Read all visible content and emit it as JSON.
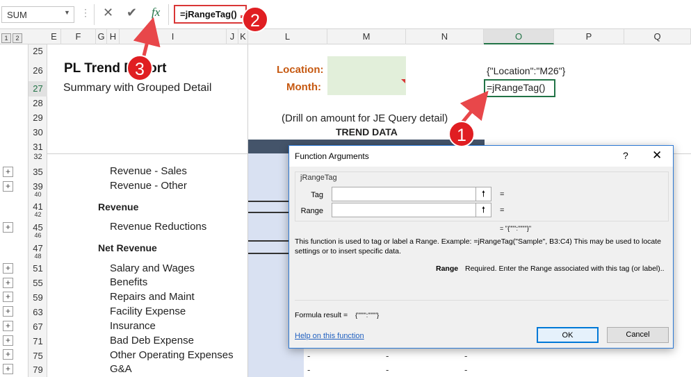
{
  "formula_bar": {
    "name_box": "SUM",
    "cancel_icon": "✕",
    "enter_icon": "✔",
    "fx_label": "fx",
    "formula": "=jRangeTag()"
  },
  "outline_levels": [
    "1",
    "2"
  ],
  "columns": [
    "E",
    "F",
    "G",
    "H",
    "I",
    "J",
    "K",
    "L",
    "M",
    "N",
    "O",
    "P",
    "Q"
  ],
  "rows_top": [
    "25",
    "26",
    "27",
    "28",
    "29",
    "30",
    "31"
  ],
  "rows_bottom": [
    "32",
    "35",
    "39",
    "40",
    "41",
    "42",
    "45",
    "46",
    "47",
    "48",
    "51",
    "55",
    "59",
    "63",
    "67",
    "71",
    "75",
    "79"
  ],
  "report": {
    "title": "PL Trend Report",
    "subtitle": "Summary with Grouped Detail",
    "location_label": "Location:",
    "month_label": "Month:",
    "drill_note": "(Drill on amount for JE Query detail)",
    "trend_header": "TREND DATA",
    "o26": "{\"Location\":\"M26\"}",
    "o27": "=jRangeTag()"
  },
  "line_items": [
    {
      "row": "35",
      "label": "Revenue - Sales",
      "bold": false
    },
    {
      "row": "39",
      "label": "Revenue - Other",
      "bold": false
    },
    {
      "row": "41",
      "label": "Revenue",
      "bold": true
    },
    {
      "row": "45",
      "label": "Revenue Reductions",
      "bold": false
    },
    {
      "row": "47",
      "label": "Net Revenue",
      "bold": true
    },
    {
      "row": "51",
      "label": "Salary and Wages",
      "bold": false
    },
    {
      "row": "55",
      "label": "Benefits",
      "bold": false
    },
    {
      "row": "59",
      "label": "Repairs and Maint",
      "bold": false
    },
    {
      "row": "63",
      "label": "Facility Expense",
      "bold": false
    },
    {
      "row": "67",
      "label": "Insurance",
      "bold": false
    },
    {
      "row": "71",
      "label": "Bad Deb Expense",
      "bold": false
    },
    {
      "row": "75",
      "label": "Other Operating Expenses",
      "bold": false
    },
    {
      "row": "79",
      "label": "G&A",
      "bold": false
    }
  ],
  "dash_value": "-",
  "dialog": {
    "title": "Function Arguments",
    "help_glyph": "?",
    "close_glyph": "✕",
    "function_name": "jRangeTag",
    "args": [
      {
        "label": "Tag",
        "value": "",
        "eq": "="
      },
      {
        "label": "Range",
        "value": "",
        "eq": "="
      }
    ],
    "result_preview": "=    \"{\"\"\":\"\"\"\"}\"",
    "description": "This function is used to tag or label a Range. Example: =jRangeTag(\"Sample\", B3:C4) This may be used to locate settings or to insert specific data.",
    "arg_name": "Range",
    "arg_description": "Required. Enter the Range associated with this tag (or label)..",
    "formula_result_label": "Formula result =",
    "formula_result_value": "{\"\"\"\":\"\"\"\"}",
    "help_link": "Help on this function",
    "ok_label": "OK",
    "cancel_label": "Cancel"
  },
  "callouts": [
    "1",
    "2",
    "3"
  ],
  "colors": {
    "accent_red": "#e01e22",
    "label_orange": "#c65911",
    "input_green": "#e2efda",
    "band_blue": "#d9e1f2",
    "header_slate": "#44546a",
    "selection_green": "#217346"
  }
}
